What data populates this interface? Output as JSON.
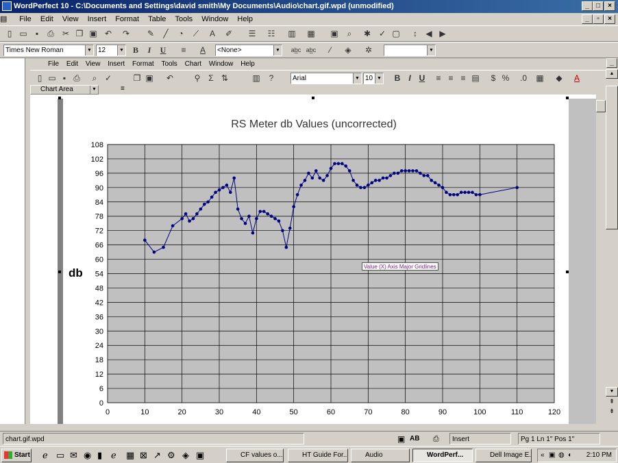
{
  "window": {
    "title": "WordPerfect 10 - C:\\Documents and Settings\\david smith\\My Documents\\Audio\\chart.gif.wpd (unmodified)"
  },
  "main_menu": [
    "File",
    "Edit",
    "View",
    "Insert",
    "Format",
    "Table",
    "Tools",
    "Window",
    "Help"
  ],
  "font_bar": {
    "font": "Times New Roman",
    "size": "12",
    "style": "<None>"
  },
  "chart_menu": [
    "File",
    "Edit",
    "View",
    "Insert",
    "Format",
    "Tools",
    "Chart",
    "Window",
    "Help"
  ],
  "chart_toolbar": {
    "font": "Arial",
    "size": "10"
  },
  "chart_selector": "Chart Area",
  "tooltip": "Value (X) Axis Major Gridlines",
  "chart_data": {
    "type": "scatter",
    "title": "RS Meter db Values (uncorrected)",
    "ylabel": "db",
    "xlabel": "",
    "xlim": [
      0,
      120
    ],
    "ylim": [
      0,
      108
    ],
    "x_ticks": [
      "0",
      "10",
      "20",
      "30",
      "40",
      "50",
      "60",
      "70",
      "80",
      "90",
      "100",
      "110",
      "120"
    ],
    "y_ticks": [
      "0",
      "6",
      "12",
      "18",
      "24",
      "30",
      "36",
      "42",
      "48",
      "54",
      "60",
      "66",
      "72",
      "78",
      "84",
      "90",
      "96",
      "102",
      "108"
    ],
    "grid": true,
    "legend": "none",
    "marker_color": "#000080",
    "plot_bg": "#c0c0c0",
    "series": [
      {
        "x": [
          10,
          12.5,
          15,
          17.5,
          20,
          21,
          22,
          23,
          24,
          25,
          26,
          27,
          28,
          29,
          30,
          31,
          32,
          33,
          34,
          35,
          36,
          37,
          38,
          39,
          40,
          41,
          42,
          43,
          44,
          45,
          46,
          47,
          48,
          49,
          50,
          51,
          52,
          53,
          54,
          55,
          56,
          57,
          58,
          59,
          60,
          61,
          62,
          63,
          64,
          65,
          66,
          67,
          68,
          69,
          70,
          71,
          72,
          73,
          74,
          75,
          76,
          77,
          78,
          79,
          80,
          81,
          82,
          83,
          84,
          85,
          86,
          87,
          88,
          89,
          90,
          91,
          92,
          93,
          94,
          95,
          96,
          97,
          98,
          99,
          100,
          110
        ],
        "y": [
          68,
          63,
          65,
          74,
          77,
          79,
          76,
          77,
          79,
          81,
          83,
          84,
          86,
          88,
          89,
          90,
          91,
          88,
          94,
          81,
          77,
          75,
          78,
          71,
          77,
          80,
          80,
          79,
          78,
          77,
          76,
          72,
          65,
          73,
          82,
          87,
          91,
          93,
          96,
          94,
          97,
          94,
          93,
          95,
          98,
          100,
          100,
          100,
          99,
          97,
          93,
          91,
          90,
          90,
          91,
          92,
          93,
          93,
          94,
          94,
          95,
          96,
          96,
          97,
          97,
          97,
          97,
          97,
          96,
          95,
          95,
          93,
          92,
          91,
          90,
          88,
          87,
          87,
          87,
          88,
          88,
          88,
          88,
          87,
          87,
          90
        ]
      }
    ]
  },
  "statusbar": {
    "doc_name": "chart.gif.wpd",
    "mode": "Insert",
    "position": "Pg 1 Ln 1\" Pos 1\""
  },
  "taskbar": {
    "start": "Start",
    "tasks": [
      "CF values o...",
      "HT Guide For...",
      "Audio",
      "WordPerf...",
      "Dell Image E..."
    ],
    "clock": "2:10 PM"
  }
}
